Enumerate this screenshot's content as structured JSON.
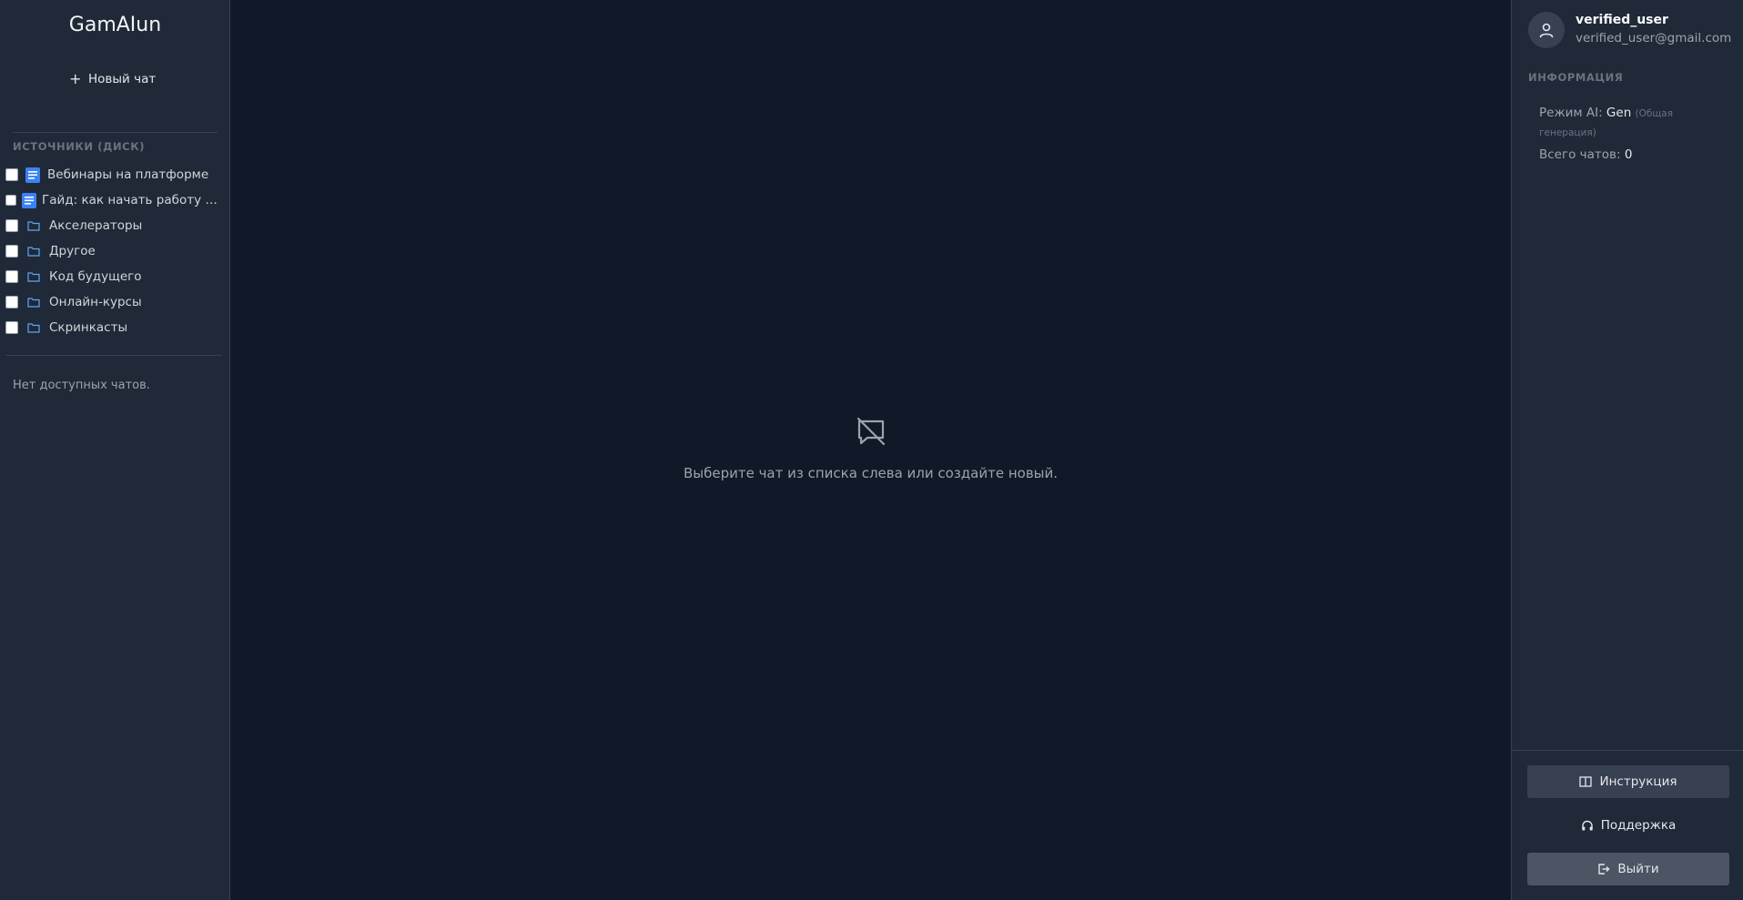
{
  "app": {
    "brand": "GamAIun"
  },
  "sidebar": {
    "new_chat_label": "Новый чат",
    "sources_title": "ИСТОЧНИКИ (ДИСК)",
    "sources": [
      {
        "label": "Вебинары на платформе",
        "icon": "doc-icon",
        "checked": false
      },
      {
        "label": "Гайд: как начать работу …",
        "icon": "doc-icon",
        "checked": false
      },
      {
        "label": "Акселераторы",
        "icon": "folder-icon",
        "checked": false
      },
      {
        "label": "Другое",
        "icon": "folder-icon",
        "checked": false
      },
      {
        "label": "Код будущего",
        "icon": "folder-icon",
        "checked": false
      },
      {
        "label": "Онлайн-курсы",
        "icon": "folder-icon",
        "checked": false
      },
      {
        "label": "Скринкасты",
        "icon": "folder-icon",
        "checked": false
      }
    ],
    "no_chats": "Нет доступных чатов."
  },
  "main": {
    "empty_icon": "chat-off-icon",
    "empty_text": "Выберите чат из списка слева или создайте новый."
  },
  "user": {
    "name": "verified_user",
    "email": "verified_user@gmail.com"
  },
  "info": {
    "title": "ИНФОРМАЦИЯ",
    "mode_label": "Режим AI:",
    "mode_value": "Gen",
    "mode_note": "(Общая генерация)",
    "chats_label": "Всего чатов:",
    "chats_value": "0"
  },
  "actions": {
    "instruction": "Инструкция",
    "support": "Поддержка",
    "logout": "Выйти"
  },
  "colors": {
    "background": "#111827",
    "panel": "#1f2937",
    "accent_blue": "#3b82f6",
    "border": "#374151"
  }
}
